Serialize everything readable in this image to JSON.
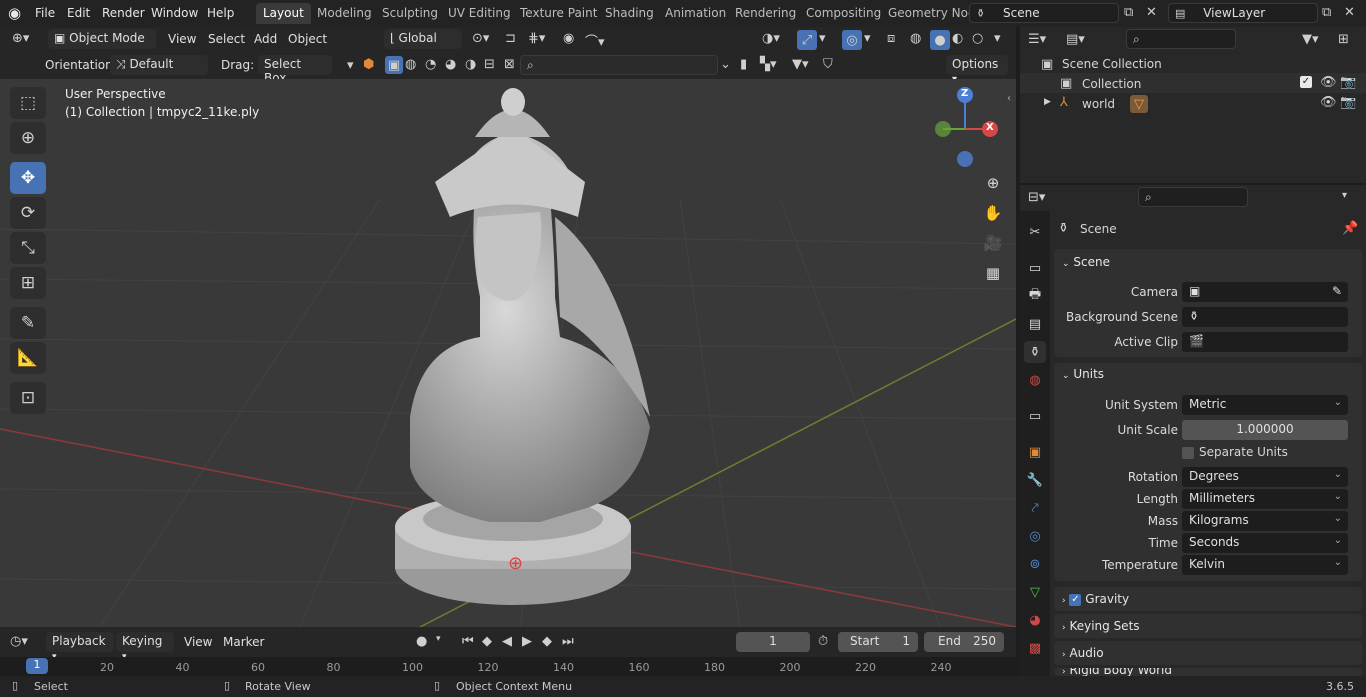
{
  "menu": {
    "file": "File",
    "edit": "Edit",
    "render": "Render",
    "window": "Window",
    "help": "Help"
  },
  "workspaces": [
    "Layout",
    "Modeling",
    "Sculpting",
    "UV Editing",
    "Texture Paint",
    "Shading",
    "Animation",
    "Rendering",
    "Compositing",
    "Geometry Noc"
  ],
  "scene_name": "Scene",
  "view_layer": "ViewLayer",
  "viewport_header": {
    "mode": "Object Mode",
    "view": "View",
    "select": "Select",
    "add": "Add",
    "object": "Object",
    "transform": "Global",
    "orientation_label": "Orientation:",
    "orientation": "Default",
    "drag_label": "Drag:",
    "drag": "Select Box",
    "options": "Options"
  },
  "viewport": {
    "perspective": "User Perspective",
    "collection_info": "(1) Collection | tmpyc2_11ke.ply",
    "gizmo_z": "Z",
    "gizmo_x": "X"
  },
  "outliner": {
    "scene_collection": "Scene Collection",
    "collection": "Collection",
    "world": "world"
  },
  "properties": {
    "header": "Scene",
    "scene_panel": "Scene",
    "camera_label": "Camera",
    "bg_scene_label": "Background Scene",
    "active_clip_label": "Active Clip",
    "units_panel": "Units",
    "unit_system_label": "Unit System",
    "unit_system": "Metric",
    "unit_scale_label": "Unit Scale",
    "unit_scale": "1.000000",
    "separate_units": "Separate Units",
    "rotation_label": "Rotation",
    "rotation": "Degrees",
    "length_label": "Length",
    "length": "Millimeters",
    "mass_label": "Mass",
    "mass": "Kilograms",
    "time_label": "Time",
    "time": "Seconds",
    "temperature_label": "Temperature",
    "temperature": "Kelvin",
    "gravity": "Gravity",
    "keying_sets": "Keying Sets",
    "audio": "Audio",
    "rigid_body": "Rigid Body World"
  },
  "timeline": {
    "playback": "Playback",
    "keying": "Keying",
    "view": "View",
    "marker": "Marker",
    "current_frame": "1",
    "start_label": "Start",
    "start": "1",
    "end_label": "End",
    "end": "250",
    "cursor_frame": "1",
    "ticks": [
      "20",
      "40",
      "60",
      "80",
      "100",
      "120",
      "140",
      "160",
      "180",
      "200",
      "220",
      "240"
    ]
  },
  "status": {
    "select": "Select",
    "rotate": "Rotate View",
    "context": "Object Context Menu",
    "version": "3.6.5"
  },
  "colors": {
    "accent": "#4772b3",
    "bg": "#393939",
    "panel": "#303030"
  }
}
